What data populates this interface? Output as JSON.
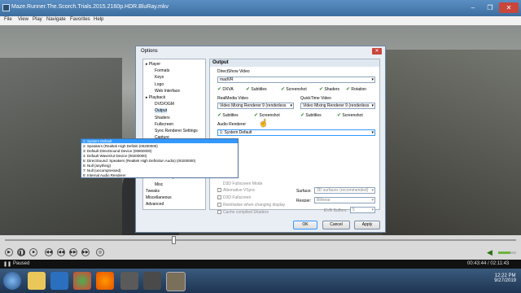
{
  "window": {
    "title": "Maze.Runner.The.Scorch.Trials.2015.2160p.HDR.BluRay.mkv",
    "controls": [
      "–",
      "❐",
      "✕"
    ]
  },
  "menu": [
    "File",
    "View",
    "Play",
    "Navigate",
    "Favorites",
    "Help"
  ],
  "options_dialog": {
    "title": "Options",
    "close": "✕",
    "tree": [
      {
        "label": "Player",
        "level": 0,
        "expander": "▸"
      },
      {
        "label": "Formats",
        "level": 1
      },
      {
        "label": "Keys",
        "level": 1
      },
      {
        "label": "Logo",
        "level": 1
      },
      {
        "label": "Web Interface",
        "level": 1
      },
      {
        "label": "Playback",
        "level": 0,
        "expander": "▸"
      },
      {
        "label": "DVD/OGM",
        "level": 1
      },
      {
        "label": "Output",
        "level": 1,
        "selected": true
      },
      {
        "label": "Shaders",
        "level": 1
      },
      {
        "label": "Fullscreen",
        "level": 1
      },
      {
        "label": "Sync Renderer Settings",
        "level": 1
      },
      {
        "label": "Capture",
        "level": 1
      },
      {
        "label": "Internal Filters",
        "level": 0,
        "expander": "▸"
      },
      {
        "label": "Audio Switcher",
        "level": 1
      },
      {
        "label": "Audio Renderer",
        "level": 1
      },
      {
        "label": "External Filters",
        "level": 0
      },
      {
        "label": "Subtitles",
        "level": 0,
        "expander": "▸"
      },
      {
        "label": "Default Style",
        "level": 1
      },
      {
        "label": "Misc",
        "level": 1
      },
      {
        "label": "Tweaks",
        "level": 0
      },
      {
        "label": "Miscellaneous",
        "level": 0
      },
      {
        "label": "Advanced",
        "level": 0
      }
    ],
    "section_header": "Output",
    "directshow": {
      "label": "DirectShow Video",
      "value": "madVR",
      "checks": [
        "DXVA",
        "Subtitles",
        "Screenshot",
        "Shaders",
        "Rotation"
      ]
    },
    "realmedia": {
      "label": "RealMedia Video",
      "value": "Video Mixing Renderer 9 (renderless",
      "checks": [
        "Subtitles",
        "Screenshot"
      ]
    },
    "quicktime": {
      "label": "QuickTime Video",
      "value": "Video Mixing Renderer 9 (renderless",
      "checks": [
        "Subtitles",
        "Screenshot"
      ]
    },
    "audio_renderer": {
      "label": "Audio Renderer",
      "value": "1: System Default",
      "options": [
        "1: System Default",
        "2: Speakers (Realtek High Definiti (00200000)",
        "3: Default DirectSound Device (00800000)",
        "4: Default WaveOut Device (00200000)",
        "5: DirectSound: Speakers (Realtek High Definition Audio) (00200000)",
        "6: Null (anything)",
        "7: Null (uncompressed)",
        "8: Internal Audio Renderer"
      ]
    },
    "partial_label": "D3D Fullscreen Mode",
    "disabled_checks": [
      "Alternative VSync",
      "D3D Fullscreen",
      "Reinitialize when changing display",
      "Cache compiled Shaders"
    ],
    "surface": {
      "label": "Surface:",
      "value": "3D surfaces (recommended)"
    },
    "resizer": {
      "label": "Resizer:",
      "value": "Bilinear"
    },
    "evr": {
      "label": "EVR Buffers:",
      "value": "5"
    },
    "buttons": {
      "ok": "OK",
      "cancel": "Cancel",
      "apply": "Apply"
    }
  },
  "player": {
    "seek_fraction": 0.33,
    "buttons": [
      "▶",
      "❚❚",
      "■",
      "◀◀",
      "◀◀",
      "▶▶",
      "▶▶",
      "◎"
    ],
    "volume_fraction": 0.7
  },
  "status": {
    "state": "Paused",
    "time": "00:43:44 / 02:11:43"
  },
  "taskbar": {
    "time": "12:22 PM",
    "date": "9/27/2019"
  },
  "colors": {
    "accent": "#3399ff",
    "check": "#2c8a2c",
    "titlebar": "#4a7db0"
  }
}
